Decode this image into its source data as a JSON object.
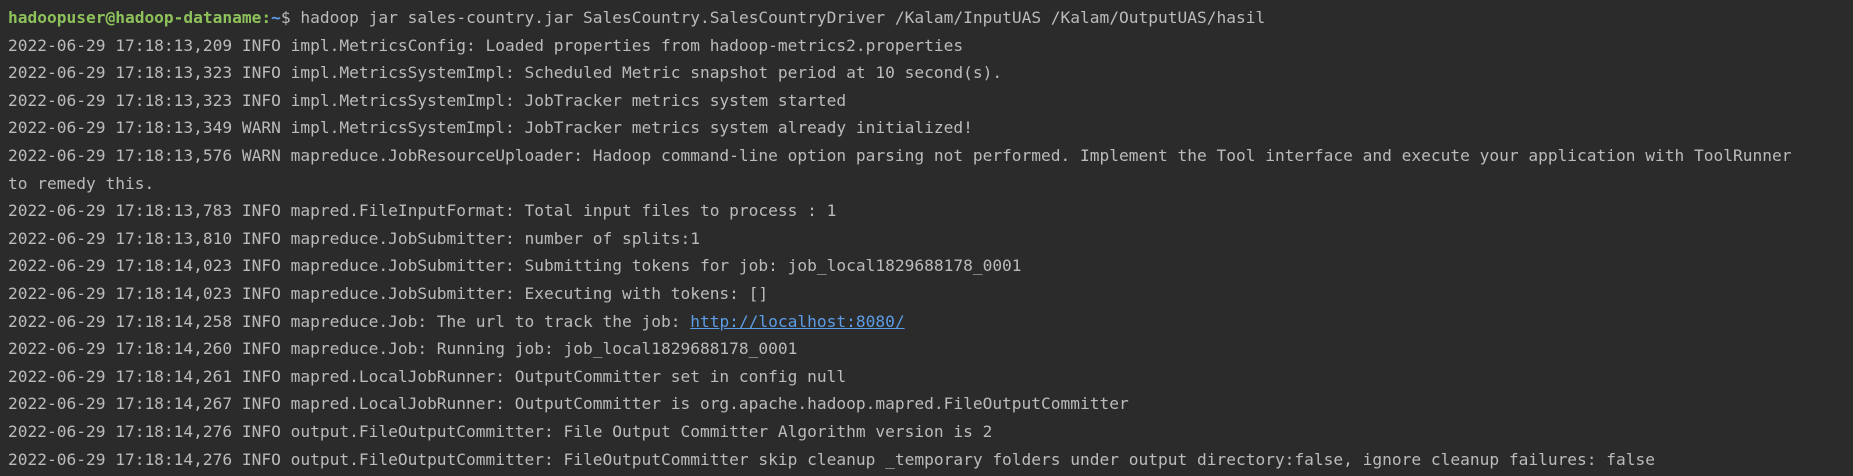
{
  "colors": {
    "background": "#2b2b2b",
    "text": "#bbbbbb",
    "prompt_user_host": "#8dc15a",
    "prompt_path": "#5c9ce6",
    "link": "#5c9ce6"
  },
  "prompt": {
    "user_host": "hadoopuser@hadoop-dataname",
    "separator": ":",
    "path": "~",
    "symbol": "$",
    "command": " hadoop jar sales-country.jar SalesCountry.SalesCountryDriver /Kalam/InputUAS /Kalam/OutputUAS/hasil"
  },
  "log": [
    "2022-06-29 17:18:13,209 INFO impl.MetricsConfig: Loaded properties from hadoop-metrics2.properties",
    "2022-06-29 17:18:13,323 INFO impl.MetricsSystemImpl: Scheduled Metric snapshot period at 10 second(s).",
    "2022-06-29 17:18:13,323 INFO impl.MetricsSystemImpl: JobTracker metrics system started",
    "2022-06-29 17:18:13,349 WARN impl.MetricsSystemImpl: JobTracker metrics system already initialized!",
    "2022-06-29 17:18:13,576 WARN mapreduce.JobResourceUploader: Hadoop command-line option parsing not performed. Implement the Tool interface and execute your application with ToolRunner",
    "to remedy this.",
    "2022-06-29 17:18:13,783 INFO mapred.FileInputFormat: Total input files to process : 1",
    "2022-06-29 17:18:13,810 INFO mapreduce.JobSubmitter: number of splits:1",
    "2022-06-29 17:18:14,023 INFO mapreduce.JobSubmitter: Submitting tokens for job: job_local1829688178_0001",
    "2022-06-29 17:18:14,023 INFO mapreduce.JobSubmitter: Executing with tokens: []"
  ],
  "url_line": {
    "prefix": "2022-06-29 17:18:14,258 INFO mapreduce.Job: The url to track the job: ",
    "url": "http://localhost:8080/"
  },
  "log_after": [
    "2022-06-29 17:18:14,260 INFO mapreduce.Job: Running job: job_local1829688178_0001",
    "2022-06-29 17:18:14,261 INFO mapred.LocalJobRunner: OutputCommitter set in config null",
    "2022-06-29 17:18:14,267 INFO mapred.LocalJobRunner: OutputCommitter is org.apache.hadoop.mapred.FileOutputCommitter",
    "2022-06-29 17:18:14,276 INFO output.FileOutputCommitter: File Output Committer Algorithm version is 2",
    "2022-06-29 17:18:14,276 INFO output.FileOutputCommitter: FileOutputCommitter skip cleanup _temporary folders under output directory:false, ignore cleanup failures: false"
  ]
}
